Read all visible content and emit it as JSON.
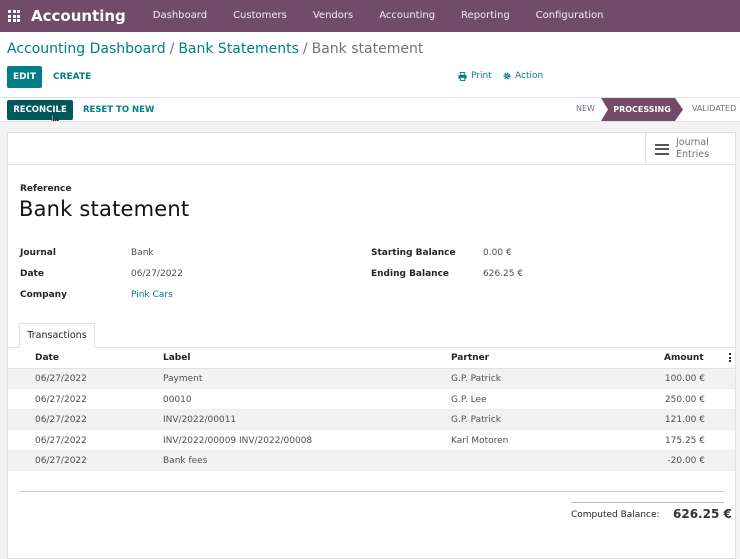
{
  "navbar": {
    "brand": "Accounting",
    "items": [
      "Dashboard",
      "Customers",
      "Vendors",
      "Accounting",
      "Reporting",
      "Configuration"
    ]
  },
  "breadcrumb": {
    "items": [
      "Accounting Dashboard",
      "Bank Statements",
      "Bank statement"
    ],
    "separator": "/"
  },
  "toolbar": {
    "edit": "EDIT",
    "create": "CREATE",
    "print": "Print",
    "action": "Action"
  },
  "statusbar": {
    "reconcile": "RECONCILE",
    "reset": "RESET TO NEW",
    "stages": [
      "NEW",
      "PROCESSING",
      "VALIDATED"
    ],
    "active_stage": "PROCESSING"
  },
  "smart_button": {
    "line1": "Journal",
    "line2": "Entries"
  },
  "form": {
    "reference_label": "Reference",
    "title": "Bank statement",
    "journal_label": "Journal",
    "journal": "Bank",
    "date_label": "Date",
    "date": "06/27/2022",
    "company_label": "Company",
    "company": "Pink Cars",
    "starting_balance_label": "Starting Balance",
    "starting_balance": "0.00 €",
    "ending_balance_label": "Ending Balance",
    "ending_balance": "626.25 €"
  },
  "tabs": [
    "Transactions"
  ],
  "table": {
    "headers": [
      "Date",
      "Label",
      "Partner",
      "Amount"
    ],
    "rows": [
      {
        "date": "06/27/2022",
        "label": "Payment",
        "partner": "G.P. Patrick",
        "amount": "100.00 €"
      },
      {
        "date": "06/27/2022",
        "label": "00010",
        "partner": "G.P. Lee",
        "amount": "250.00 €"
      },
      {
        "date": "06/27/2022",
        "label": "INV/2022/00011",
        "partner": "G.P. Patrick",
        "amount": "121.00 €"
      },
      {
        "date": "06/27/2022",
        "label": "INV/2022/00009 INV/2022/00008",
        "partner": "Karl Motoren",
        "amount": "175.25 €"
      },
      {
        "date": "06/27/2022",
        "label": "Bank fees",
        "partner": "",
        "amount": "-20.00 €"
      }
    ]
  },
  "footer": {
    "computed_label": "Computed Balance:",
    "computed_value": "626.25 €"
  },
  "colors": {
    "brand": "#714B67",
    "primary": "#017e84",
    "primary_dark": "#00585b",
    "stage_active": "#714B67"
  }
}
